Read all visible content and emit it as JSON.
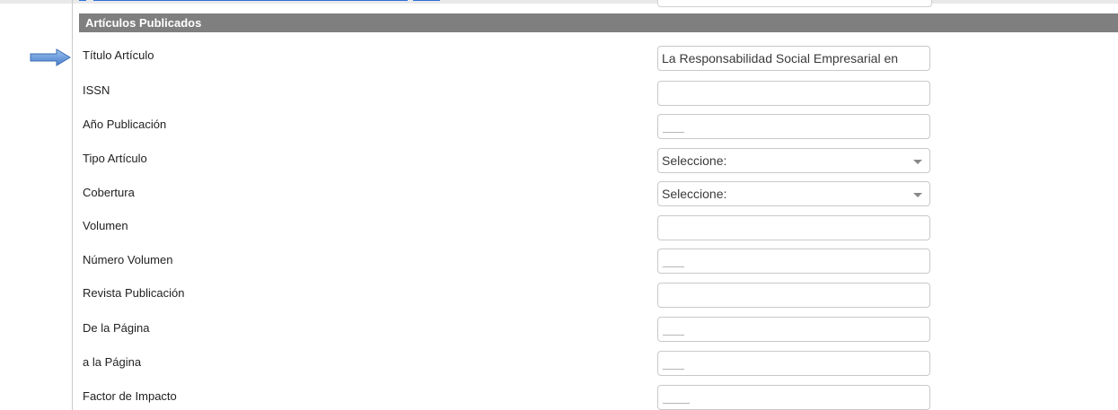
{
  "section": {
    "title": "Artículos Publicados"
  },
  "fields": {
    "titulo_articulo": {
      "label": "Título Artículo",
      "value": "La Responsabilidad Social Empresarial en"
    },
    "issn": {
      "label": "ISSN",
      "value": ""
    },
    "anio_publicacion": {
      "label": "Año Publicación",
      "value": ""
    },
    "tipo_articulo": {
      "label": "Tipo Artículo",
      "value": "Seleccione:"
    },
    "cobertura": {
      "label": "Cobertura",
      "value": "Seleccione:"
    },
    "volumen": {
      "label": "Volumen",
      "value": ""
    },
    "numero_volumen": {
      "label": "Número Volumen",
      "value": ""
    },
    "revista_publicacion": {
      "label": "Revista Publicación",
      "value": ""
    },
    "de_la_pagina": {
      "label": "De la Página",
      "value": ""
    },
    "a_la_pagina": {
      "label": "a la Página",
      "value": ""
    },
    "factor_impacto": {
      "label": "Factor de Impacto",
      "value": ""
    }
  },
  "colors": {
    "header_bg": "#7f7f7f",
    "header_text": "#ffffff",
    "arrow": "#5b8fd6",
    "link": "#2e6fd8"
  },
  "icons": {
    "pointer": "arrow-right-icon",
    "dropdown": "chevron-down-icon"
  }
}
